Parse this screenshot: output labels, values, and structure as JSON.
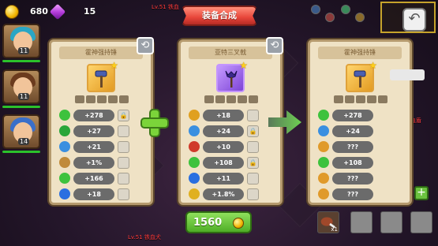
{
  "resources": {
    "gold": "680",
    "gems": "15"
  },
  "title": "装备合成",
  "heroes": [
    {
      "level": "11",
      "hair_color": "#2aa6c4"
    },
    {
      "level": "11",
      "hair_color": "#6b3b1e"
    },
    {
      "level": "14",
      "hair_color": "#3a6fc9"
    }
  ],
  "panels": [
    {
      "name": "霍神强持锤",
      "rarity": "gold",
      "refresh_icon": "refresh-icon",
      "stats": [
        {
          "icon": "green-shield-icon",
          "color": "#3dc23d",
          "value": "+278",
          "locked": true
        },
        {
          "icon": "green-swirl-icon",
          "color": "#2aa63a",
          "value": "+27",
          "locked": false
        },
        {
          "icon": "blue-shield-icon",
          "color": "#3a8fe0",
          "value": "+21",
          "locked": false
        },
        {
          "icon": "boot-icon",
          "color": "#c08a3a",
          "value": "+1%",
          "locked": false
        },
        {
          "icon": "green-shield-icon",
          "color": "#3dc23d",
          "value": "+166",
          "locked": false
        },
        {
          "icon": "blue-star-icon",
          "color": "#2a6fe0",
          "value": "+18",
          "locked": false
        }
      ]
    },
    {
      "name": "亚特三叉戟",
      "rarity": "purple",
      "refresh_icon": "refresh-icon",
      "stats": [
        {
          "icon": "gold-gear-icon",
          "color": "#e0a020",
          "value": "+18",
          "locked": false
        },
        {
          "icon": "blue-shield-icon",
          "color": "#3a8fe0",
          "value": "+24",
          "locked": true
        },
        {
          "icon": "red-target-icon",
          "color": "#d03a2a",
          "value": "+10",
          "locked": false
        },
        {
          "icon": "green-shield-icon",
          "color": "#3dc23d",
          "value": "+108",
          "locked": true
        },
        {
          "icon": "blue-star-icon",
          "color": "#2a6fe0",
          "value": "+11",
          "locked": false
        },
        {
          "icon": "gold-sword-icon",
          "color": "#e0b020",
          "value": "+1.8%",
          "locked": false
        }
      ]
    },
    {
      "name": "霍神强持锤",
      "rarity": "gold",
      "refresh_icon": "refresh-icon",
      "stats": [
        {
          "icon": "green-shield-icon",
          "color": "#3dc23d",
          "value": "+278",
          "locked": false
        },
        {
          "icon": "blue-shield-icon",
          "color": "#3a8fe0",
          "value": "+24",
          "locked": false
        },
        {
          "icon": "unknown-icon",
          "color": "#e09a2a",
          "value": "???",
          "locked": false
        },
        {
          "icon": "green-shield-icon",
          "color": "#3dc23d",
          "value": "+108",
          "locked": false
        },
        {
          "icon": "unknown-icon",
          "color": "#e09a2a",
          "value": "???",
          "locked": false
        },
        {
          "icon": "unknown-icon",
          "color": "#e09a2a",
          "value": "???",
          "locked": false
        }
      ]
    }
  ],
  "cost": "1560",
  "side_labels": {
    "lv_left_top": "Lv.51 铁血",
    "lv_bottom": "Lv.51 铁血犬",
    "lv_right": "Lv.51 铁血盾"
  },
  "inventory": {
    "meat_count": "x1"
  }
}
